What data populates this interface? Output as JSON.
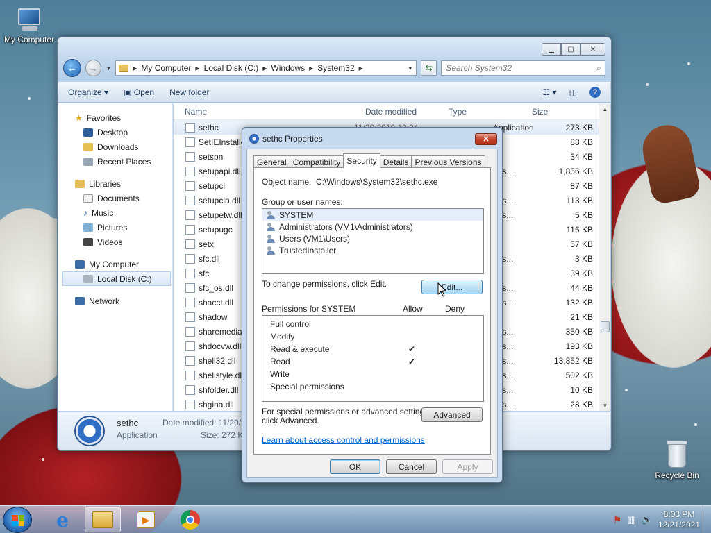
{
  "desktop": {
    "icons": [
      {
        "label": "My Computer"
      },
      {
        "label": "Recycle Bin"
      }
    ]
  },
  "explorer": {
    "address": {
      "crumbs": [
        "My Computer",
        "Local Disk (C:)",
        "Windows",
        "System32"
      ]
    },
    "search_placeholder": "Search System32",
    "toolbar": {
      "organize": "Organize",
      "open": "Open",
      "new_folder": "New folder"
    },
    "nav": {
      "favorites": "Favorites",
      "desktop": "Desktop",
      "downloads": "Downloads",
      "recent_places": "Recent Places",
      "libraries": "Libraries",
      "documents": "Documents",
      "music": "Music",
      "pictures": "Pictures",
      "videos": "Videos",
      "my_computer": "My Computer",
      "local_disk": "Local Disk (C:)",
      "network": "Network"
    },
    "columns": {
      "name": "Name",
      "date_modified": "Date modified",
      "type": "Type",
      "size": "Size"
    },
    "files": [
      {
        "name": "sethc",
        "date": "11/20/2010 10:24",
        "type": "Application",
        "size": "273 KB"
      },
      {
        "name": "SetIEInstalle",
        "type": "",
        "size": "88 KB"
      },
      {
        "name": "setspn",
        "type": "",
        "size": "34 KB"
      },
      {
        "name": "setupapi.dll",
        "type": "ens...",
        "size": "1,856 KB"
      },
      {
        "name": "setupcl",
        "type": "",
        "size": "87 KB"
      },
      {
        "name": "setupcln.dll",
        "type": "ens...",
        "size": "113 KB"
      },
      {
        "name": "setupetw.dll",
        "type": "ens...",
        "size": "5 KB"
      },
      {
        "name": "setupugc",
        "type": "",
        "size": "116 KB"
      },
      {
        "name": "setx",
        "type": "",
        "size": "57 KB"
      },
      {
        "name": "sfc.dll",
        "type": "ens...",
        "size": "3 KB"
      },
      {
        "name": "sfc",
        "type": "",
        "size": "39 KB"
      },
      {
        "name": "sfc_os.dll",
        "type": "ens...",
        "size": "44 KB"
      },
      {
        "name": "shacct.dll",
        "type": "ens...",
        "size": "132 KB"
      },
      {
        "name": "shadow",
        "type": "",
        "size": "21 KB"
      },
      {
        "name": "sharemedia",
        "type": "ens...",
        "size": "350 KB"
      },
      {
        "name": "shdocvw.dll",
        "type": "ens...",
        "size": "193 KB"
      },
      {
        "name": "shell32.dll",
        "type": "ens...",
        "size": "13,852 KB"
      },
      {
        "name": "shellstyle.dll",
        "type": "ens...",
        "size": "502 KB"
      },
      {
        "name": "shfolder.dll",
        "type": "ens...",
        "size": "10 KB"
      },
      {
        "name": "shgina.dll",
        "type": "ens...",
        "size": "28 KB"
      }
    ],
    "details": {
      "name": "sethc",
      "type": "Application",
      "date_label": "Date modified: 11/20/",
      "size_label": "Size: 272 KB"
    }
  },
  "dialog": {
    "title": "sethc Properties",
    "tabs": [
      "General",
      "Compatibility",
      "Security",
      "Details",
      "Previous Versions"
    ],
    "active_tab": "Security",
    "object_label": "Object name:",
    "object_value": "C:\\Windows\\System32\\sethc.exe",
    "group_label": "Group or user names:",
    "users": [
      "SYSTEM",
      "Administrators (VM1\\Administrators)",
      "Users (VM1\\Users)",
      "TrustedInstaller"
    ],
    "change_text": "To change permissions, click Edit.",
    "edit_button": "Edit...",
    "perm_label": "Permissions for SYSTEM",
    "allow_label": "Allow",
    "deny_label": "Deny",
    "permissions": [
      {
        "name": "Full control",
        "allow": "",
        "deny": ""
      },
      {
        "name": "Modify",
        "allow": "",
        "deny": ""
      },
      {
        "name": "Read & execute",
        "allow": "✔",
        "deny": ""
      },
      {
        "name": "Read",
        "allow": "✔",
        "deny": ""
      },
      {
        "name": "Write",
        "allow": "",
        "deny": ""
      },
      {
        "name": "Special permissions",
        "allow": "",
        "deny": ""
      }
    ],
    "special_text_1": "For special permissions or advanced settings,",
    "special_text_2": "click Advanced.",
    "advanced_button": "Advanced",
    "learn_link": "Learn about access control and permissions",
    "ok": "OK",
    "cancel": "Cancel",
    "apply": "Apply"
  },
  "taskbar": {
    "time": "8:03 PM",
    "date": "12/21/2021"
  }
}
